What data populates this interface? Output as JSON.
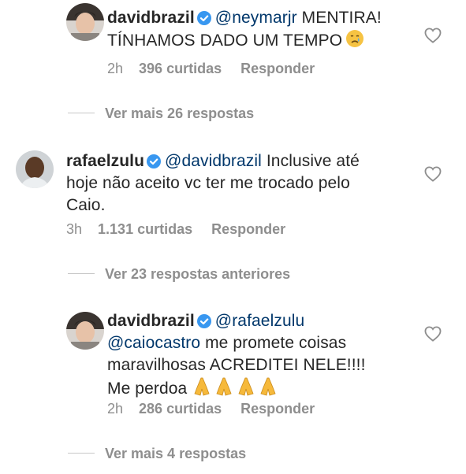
{
  "comments": [
    {
      "username": "davidbrazil",
      "mention": "@neymarjr",
      "text_line1": "MENTIRA!",
      "text_line2": "TÍNHAMOS DADO UM TEMPO",
      "emoji": "crying-face-icon",
      "time": "2h",
      "likes": "396 curtidas",
      "reply": "Responder",
      "thread_link": "Ver mais 26 respostas"
    },
    {
      "username": "rafaelzulu",
      "mention": "@davidbrazil",
      "text_line1": "Inclusive até",
      "text_line2": "hoje não aceito vc ter me trocado pelo",
      "text_line3": "Caio.",
      "time": "3h",
      "likes": "1.131 curtidas",
      "reply": "Responder",
      "thread_link": "Ver 23 respostas anteriores"
    },
    {
      "username": "davidbrazil",
      "mention": "@rafaelzulu",
      "mention2": "@caiocastro",
      "text_line2": "me promete coisas",
      "text_line3": "maravilhosas ACREDITEI NELE!!!!",
      "text_line4": "Me perdoa",
      "emoji": "praying-hands-icon",
      "time": "2h",
      "likes": "286 curtidas",
      "reply": "Responder",
      "thread_link": "Ver mais 4 respostas"
    }
  ],
  "colors": {
    "text": "#262626",
    "mention": "#00376b",
    "secondary": "#8e8e8e",
    "verified": "#3897f0"
  }
}
